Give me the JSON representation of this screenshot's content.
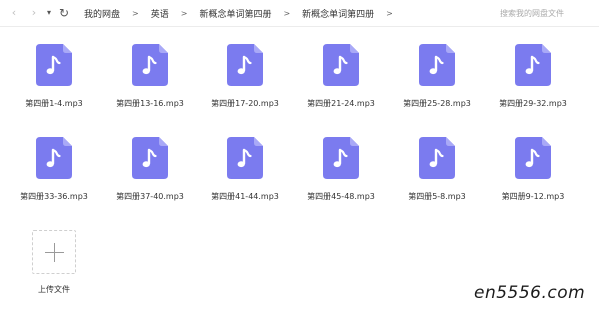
{
  "nav": {
    "back": "‹",
    "forward": "›",
    "dropdown": "▾",
    "refresh": "↻"
  },
  "breadcrumbs": [
    "我的网盘",
    "英语",
    "新概念单词第四册",
    "新概念单词第四册"
  ],
  "breadcrumb_separator": ">",
  "search": {
    "placeholder": "搜索我的网盘文件"
  },
  "files": [
    {
      "name": "第四册1-4.mp3"
    },
    {
      "name": "第四册13-16.mp3"
    },
    {
      "name": "第四册17-20.mp3"
    },
    {
      "name": "第四册21-24.mp3"
    },
    {
      "name": "第四册25-28.mp3"
    },
    {
      "name": "第四册29-32.mp3"
    },
    {
      "name": "第四册33-36.mp3"
    },
    {
      "name": "第四册37-40.mp3"
    },
    {
      "name": "第四册41-44.mp3"
    },
    {
      "name": "第四册45-48.mp3"
    },
    {
      "name": "第四册5-8.mp3"
    },
    {
      "name": "第四册9-12.mp3"
    }
  ],
  "upload": {
    "label": "上传文件"
  },
  "watermark": "en5556.com",
  "colors": {
    "audio_icon": "#7B7BEF",
    "audio_icon_fold": "#A9A9F7"
  },
  "icons": {
    "file": "music-note-icon",
    "upload": "plus-icon"
  }
}
